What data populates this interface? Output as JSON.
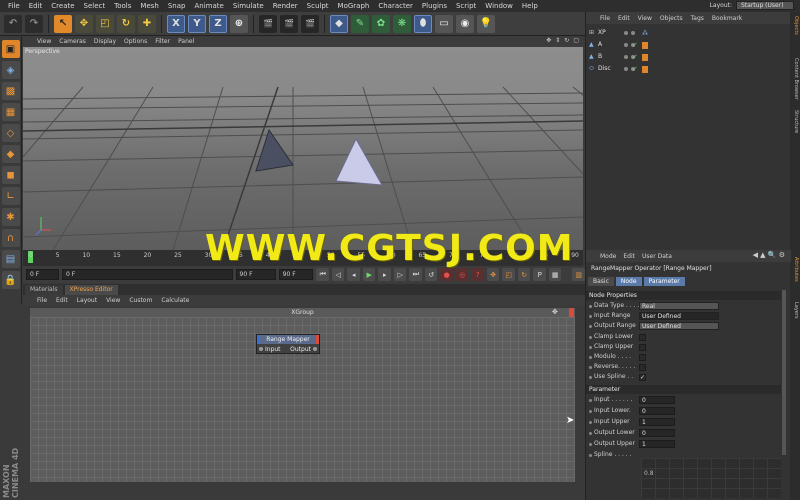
{
  "menubar": {
    "items": [
      "File",
      "Edit",
      "Create",
      "Select",
      "Tools",
      "Mesh",
      "Snap",
      "Animate",
      "Simulate",
      "Render",
      "Sculpt",
      "MoGraph",
      "Character",
      "Plugins",
      "Script",
      "Window",
      "Help"
    ],
    "layout_label": "Layout:",
    "layout_value": "Startup (User)"
  },
  "viewport": {
    "menu": [
      "View",
      "Cameras",
      "Display",
      "Options",
      "Filter",
      "Panel"
    ],
    "label": "Perspective"
  },
  "timeline": {
    "ticks": [
      "0",
      "5",
      "10",
      "15",
      "20",
      "25",
      "30",
      "35",
      "40",
      "45",
      "50",
      "55",
      "60",
      "65",
      "70",
      "75",
      "80",
      "85",
      "90"
    ],
    "start_field": "0 F",
    "current_field": "0 F",
    "end_field": "90 F",
    "max_field": "90 F"
  },
  "bottom_tabs": [
    "Materials",
    "XPresso Editor"
  ],
  "xpresso": {
    "menu": [
      "File",
      "Edit",
      "Layout",
      "View",
      "Custom",
      "Calculate"
    ],
    "group_title": "XGroup",
    "node": {
      "title": "Range Mapper",
      "input": "Input",
      "output": "Output"
    }
  },
  "watermark": "WWW.CGTSJ.COM",
  "objects": {
    "menu": [
      "File",
      "Edit",
      "View",
      "Objects",
      "Tags",
      "Bookmark"
    ],
    "rows": [
      {
        "name": "XP"
      },
      {
        "name": "A"
      },
      {
        "name": "B"
      },
      {
        "name": "Disc"
      }
    ]
  },
  "side_tabs": [
    "Objects",
    "Content Browser",
    "Structure",
    "Attributes",
    "Layers"
  ],
  "attributes": {
    "menu": [
      "Mode",
      "Edit",
      "User Data"
    ],
    "title": "RangeMapper Operator [Range Mapper]",
    "tabs": [
      "Basic",
      "Node",
      "Parameter"
    ],
    "section_node": "Node Properties",
    "node_props": [
      {
        "label": "Data Type . . . .",
        "value": "Real",
        "kind": "dd"
      },
      {
        "label": "Input Range",
        "value": "User Defined",
        "kind": "dd"
      },
      {
        "label": "Output Range",
        "value": "User Defined",
        "kind": "dd"
      },
      {
        "label": "Clamp Lower",
        "value": "",
        "kind": "cb"
      },
      {
        "label": "Clamp Upper",
        "value": "",
        "kind": "cb"
      },
      {
        "label": "Modulo . . . .",
        "value": "",
        "kind": "cb"
      },
      {
        "label": "Reverse. . . . .",
        "value": "",
        "kind": "cb"
      },
      {
        "label": "Use Spline . .",
        "value": "✓",
        "kind": "cb"
      }
    ],
    "section_param": "Parameter",
    "param_props": [
      {
        "label": "Input . . . . . .",
        "value": "0"
      },
      {
        "label": "Input Lower.",
        "value": "0"
      },
      {
        "label": "Input Upper",
        "value": "1"
      },
      {
        "label": "Output Lower",
        "value": "0"
      },
      {
        "label": "Output Upper",
        "value": "1"
      }
    ],
    "spline_label": "Spline . . . . .",
    "spline_value": "0.8"
  },
  "brand": "MAXON CINEMA 4D"
}
